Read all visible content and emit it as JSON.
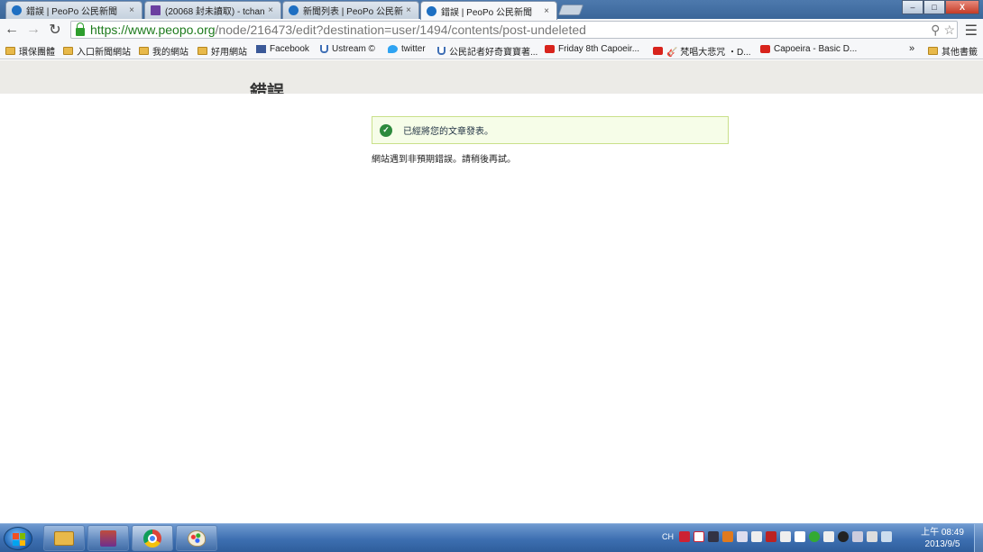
{
  "browser": {
    "tabs": [
      {
        "label": "錯誤 | PeoPo 公民新聞",
        "icon": "drupal-icon",
        "active": false
      },
      {
        "label": "(20068 封未讀取) - tchan",
        "icon": "mail-icon",
        "active": false
      },
      {
        "label": "新聞列表 | PeoPo 公民新",
        "icon": "drupal-icon",
        "active": false
      },
      {
        "label": "錯誤 | PeoPo 公民新聞",
        "icon": "drupal-icon",
        "active": true
      }
    ],
    "tab_close": "×",
    "window_buttons": {
      "minimize": "–",
      "maximize": "□",
      "close": "X"
    },
    "url_host": "https://www.peopo.org",
    "url_path": "/node/216473/edit?destination=user/1494/contents/post-undeleted",
    "bookmarks": [
      {
        "label": "環保團體",
        "icon": "folder-icon"
      },
      {
        "label": "入口新聞網站",
        "icon": "folder-icon"
      },
      {
        "label": "我的網站",
        "icon": "folder-icon"
      },
      {
        "label": "好用網站",
        "icon": "folder-icon"
      },
      {
        "label": "Facebook",
        "icon": "facebook-icon"
      },
      {
        "label": "Ustream ©",
        "icon": "ustream-icon"
      },
      {
        "label": "twitter",
        "icon": "twitter-icon"
      },
      {
        "label": "公民記者好奇寶寶著...",
        "icon": "ustream-icon"
      },
      {
        "label": "Friday 8th Capoeir...",
        "icon": "youtube-icon"
      },
      {
        "label": "🎸 梵唱大悲咒 ・D...",
        "icon": "youtube-icon"
      },
      {
        "label": "Capoeira - Basic D...",
        "icon": "youtube-icon"
      }
    ],
    "bookmarks_more": "»",
    "other_bookmarks": "其他書籤"
  },
  "page": {
    "title": "錯誤",
    "status_message": "已經將您的文章發表。",
    "error_message": "網站遇到非預期錯誤。請稍後再試。"
  },
  "taskbar": {
    "apps": [
      "windows-explorer",
      "winrar",
      "google-chrome",
      "paint"
    ],
    "active_app": "google-chrome",
    "language": "CH",
    "time": "上午 08:49",
    "date": "2013/9/5"
  },
  "colors": {
    "accent_green": "#2d8a3d",
    "message_bg": "#f6fde8",
    "message_border": "#c9e08a",
    "header_bg": "#ecebe7",
    "taskbar_blue": "#3d6fb1"
  }
}
